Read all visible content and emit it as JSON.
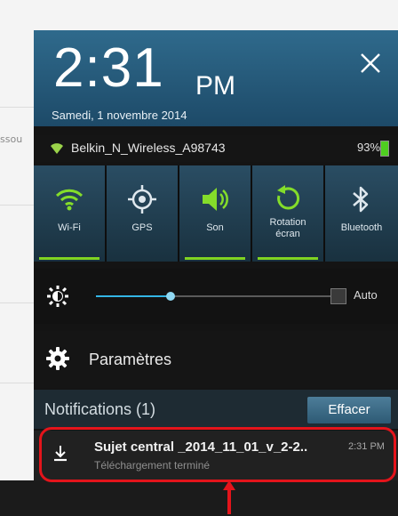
{
  "background": {
    "partial_text": "ssou"
  },
  "header": {
    "time": "2:31",
    "ampm": "PM",
    "date": "Samedi, 1 novembre 2014"
  },
  "status": {
    "ssid": "Belkin_N_Wireless_A98743",
    "battery": "93%",
    "battery_color": "#4fcf20"
  },
  "toggles": [
    {
      "label": "Wi-Fi",
      "icon": "wifi-icon",
      "active": true
    },
    {
      "label": "GPS",
      "icon": "gps-icon",
      "active": false
    },
    {
      "label": "Son",
      "icon": "speaker-icon",
      "active": true
    },
    {
      "label": "Rotation\nécran",
      "icon": "rotation-icon",
      "active": true
    },
    {
      "label": "Bluetooth",
      "icon": "bluetooth-icon",
      "active": false
    }
  ],
  "brightness": {
    "level": 0.3,
    "auto_label": "Auto",
    "auto_checked": false
  },
  "settings": {
    "label": "Paramètres"
  },
  "notifications": {
    "title": "Notifications (1)",
    "clear_label": "Effacer",
    "items": [
      {
        "title": "Sujet central _2014_11_01_v_2-2..",
        "time": "2:31 PM",
        "subtitle": "Téléchargement terminé"
      }
    ]
  },
  "colors": {
    "accent_green": "#7fd321",
    "slider_blue": "#33b5e5",
    "annotation_red": "#e4141b"
  }
}
